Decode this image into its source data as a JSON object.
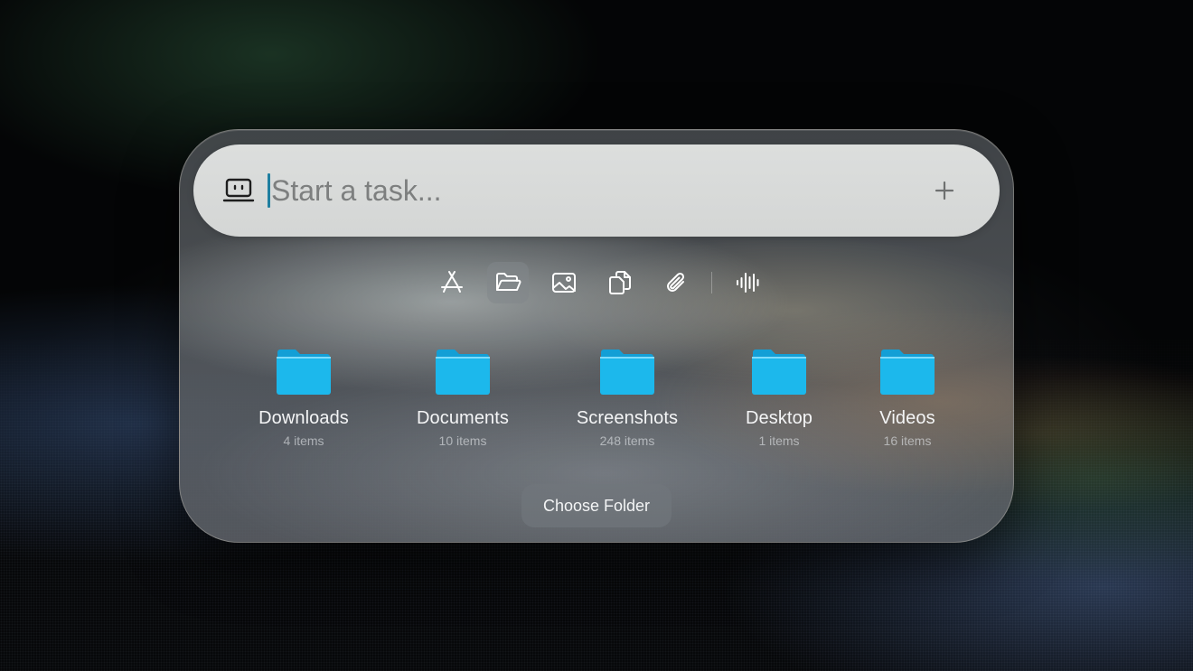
{
  "search": {
    "placeholder": "Start a task...",
    "value": ""
  },
  "toolbar": {
    "tools": [
      {
        "name": "apps",
        "icon": "app-store-icon",
        "active": false
      },
      {
        "name": "folders",
        "icon": "folder-open-icon",
        "active": true
      },
      {
        "name": "images",
        "icon": "image-icon",
        "active": false
      },
      {
        "name": "documents",
        "icon": "copy-files-icon",
        "active": false
      },
      {
        "name": "attachments",
        "icon": "paperclip-icon",
        "active": false
      },
      {
        "name": "voice",
        "icon": "waveform-icon",
        "active": false
      }
    ]
  },
  "folders": [
    {
      "name": "Downloads",
      "count": "4 items"
    },
    {
      "name": "Documents",
      "count": "10 items"
    },
    {
      "name": "Screenshots",
      "count": "248 items"
    },
    {
      "name": "Desktop",
      "count": "1 items"
    },
    {
      "name": "Videos",
      "count": "16 items"
    }
  ],
  "choose_folder_label": "Choose Folder",
  "colors": {
    "caret": "#1f7fa0",
    "folder_blue": "#1cb8ec",
    "folder_tab": "#139fd6"
  }
}
